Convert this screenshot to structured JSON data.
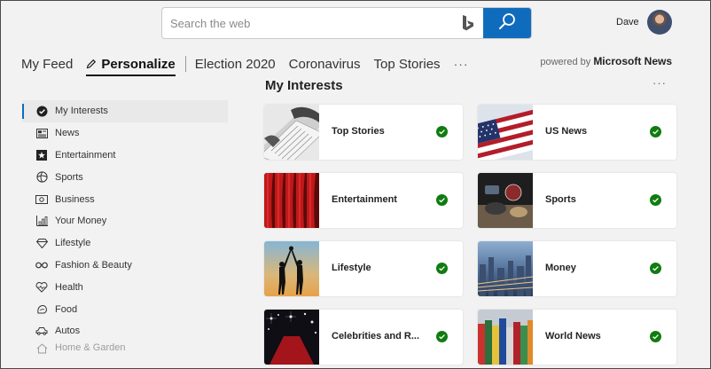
{
  "search": {
    "placeholder": "Search the web",
    "value": ""
  },
  "user": {
    "name": "Dave"
  },
  "nav": {
    "items": [
      {
        "label": "My Feed"
      },
      {
        "label": "Personalize",
        "active": true
      },
      {
        "label": "Election 2020"
      },
      {
        "label": "Coronavirus"
      },
      {
        "label": "Top Stories"
      }
    ],
    "more": "···"
  },
  "powered": {
    "prefix": "powered by",
    "brand": "Microsoft News"
  },
  "sidebar": {
    "items": [
      {
        "label": "My Interests",
        "icon": "check-circle-icon",
        "active": true
      },
      {
        "label": "News",
        "icon": "newspaper-icon"
      },
      {
        "label": "Entertainment",
        "icon": "star-icon"
      },
      {
        "label": "Sports",
        "icon": "ball-icon"
      },
      {
        "label": "Business",
        "icon": "money-icon"
      },
      {
        "label": "Your Money",
        "icon": "bar-chart-icon"
      },
      {
        "label": "Lifestyle",
        "icon": "diamond-icon"
      },
      {
        "label": "Fashion & Beauty",
        "icon": "glasses-icon"
      },
      {
        "label": "Health",
        "icon": "heart-pulse-icon"
      },
      {
        "label": "Food",
        "icon": "food-icon"
      },
      {
        "label": "Autos",
        "icon": "car-icon"
      },
      {
        "label": "Home & Garden",
        "icon": "home-icon"
      }
    ]
  },
  "main": {
    "title": "My Interests",
    "more": "···",
    "cards": [
      {
        "label": "Top Stories",
        "selected": true,
        "thumb": "newspapers"
      },
      {
        "label": "US News",
        "selected": true,
        "thumb": "flag"
      },
      {
        "label": "Entertainment",
        "selected": true,
        "thumb": "curtain"
      },
      {
        "label": "Sports",
        "selected": true,
        "thumb": "sports"
      },
      {
        "label": "Lifestyle",
        "selected": true,
        "thumb": "silhouettes"
      },
      {
        "label": "Money",
        "selected": true,
        "thumb": "city"
      },
      {
        "label": "Celebrities and R...",
        "selected": true,
        "thumb": "redcarpet"
      },
      {
        "label": "World News",
        "selected": true,
        "thumb": "flags"
      }
    ]
  },
  "colors": {
    "accent": "#0f6cbd",
    "check": "#107c10",
    "background": "#f2f2f2"
  }
}
